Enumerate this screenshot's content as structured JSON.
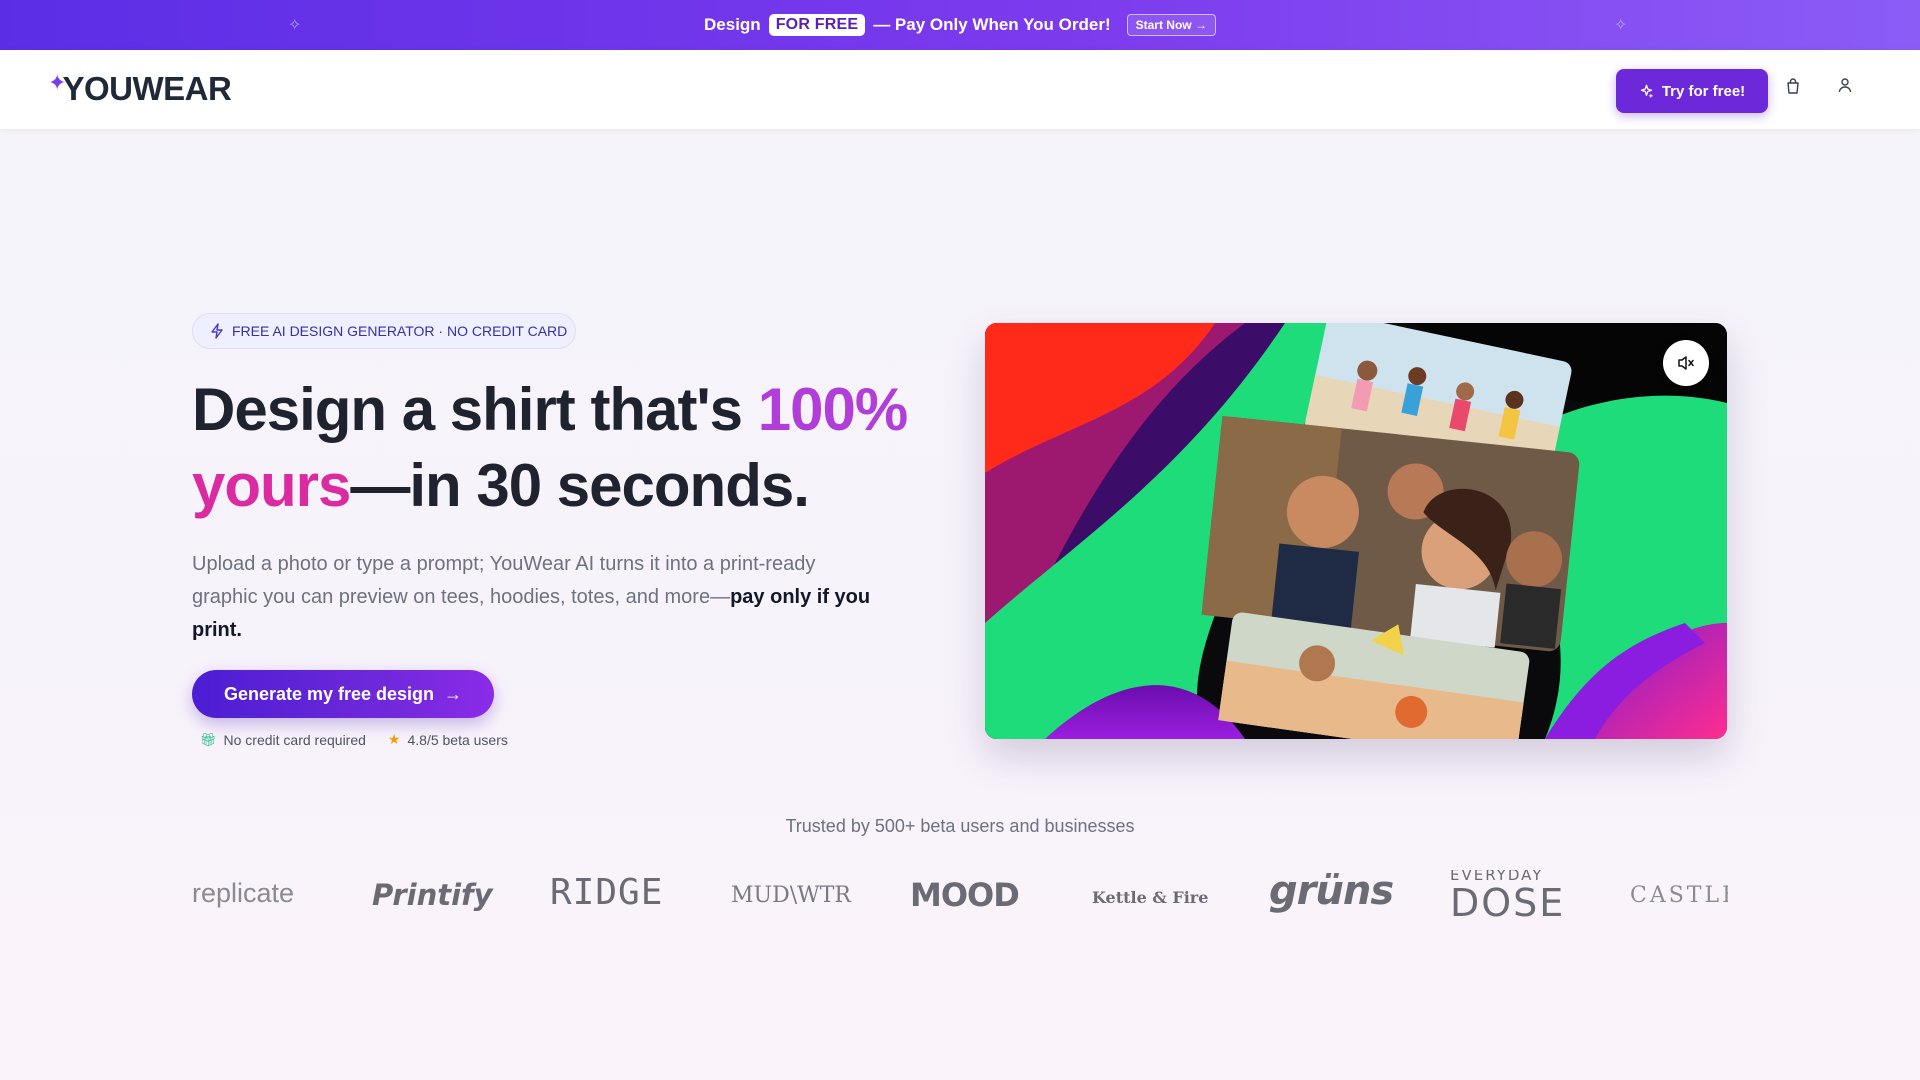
{
  "promo": {
    "prefix": "Design",
    "highlight": "FOR FREE",
    "suffix": "— Pay Only When You Order!",
    "button": "Start Now →"
  },
  "header": {
    "logo": "YOUWEAR",
    "try_button": "Try for free!",
    "icons": [
      "sparkle-icon",
      "shopping-bag-icon",
      "user-icon"
    ]
  },
  "hero": {
    "badge": "FREE AI DESIGN GENERATOR · NO CREDIT CARD",
    "headline": {
      "part1": "Design a shirt that's ",
      "accent1": "100%",
      "accent2": "yours",
      "part2": "—in 30 seconds."
    },
    "subtext": "Upload a photo or type a prompt; YouWear AI turns it into a print-ready graphic you can preview on tees, hoodies, totes, and more—",
    "subtext_bold": "pay only if you print.",
    "cta": "Generate my free design",
    "meta": {
      "no_card": "No credit card required",
      "rating": "4.8/5 beta users"
    }
  },
  "video": {
    "mute_icon": "volume-mute-icon"
  },
  "trusted": {
    "title": "Trusted by 500+ beta users and businesses",
    "brands": [
      "replicate",
      "Printify",
      "RIDGE",
      "MUD\\WTR",
      "MOOD",
      "Kettle & Fire",
      "grüns",
      "EVERYDAY",
      "DOSE",
      "CASTLE"
    ]
  },
  "colors": {
    "brand": "#6d28d9",
    "accent_purple": "#b13ed8",
    "accent_pink": "#db2ba0"
  }
}
